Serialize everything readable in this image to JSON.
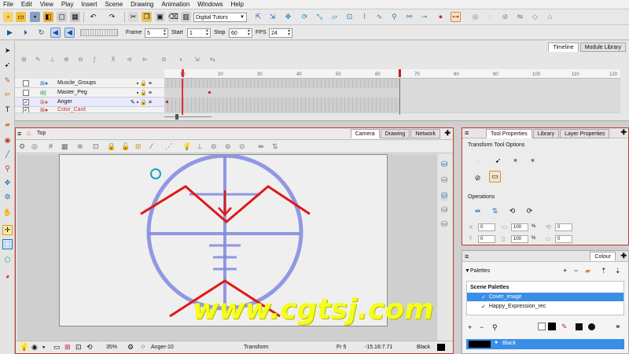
{
  "menu": [
    "File",
    "Edit",
    "View",
    "Play",
    "Insert",
    "Scene",
    "Drawing",
    "Animation",
    "Windows",
    "Help"
  ],
  "toolbar": {
    "workspace": "Digital Tutors",
    "frame_label": "Frame",
    "frame_value": "5",
    "start_label": "Start",
    "start_value": "1",
    "stop_label": "Stop",
    "stop_value": "60",
    "fps_label": "FPS",
    "fps_value": "24"
  },
  "timeline": {
    "tabs": [
      "Timeline",
      "Module Library"
    ],
    "ruler_ticks": [
      "10",
      "20",
      "30",
      "40",
      "50",
      "60",
      "70",
      "80",
      "90",
      "100",
      "110",
      "120"
    ],
    "layers": [
      {
        "name": "Muscle_Groups",
        "checked": false
      },
      {
        "name": "Master_Peg",
        "checked": false
      },
      {
        "name": "Anger",
        "checked": true
      },
      {
        "name": "Color_Card",
        "checked": true
      }
    ]
  },
  "camera": {
    "breadcrumb": "Top",
    "tabs": [
      "Camera",
      "Drawing",
      "Network"
    ],
    "status": {
      "zoom": "35%",
      "drawing": "Anger-10",
      "tool": "Transform",
      "frame": "Fr 5",
      "coords": "-15.16:7.71",
      "color": "Black"
    }
  },
  "tool_properties": {
    "tabs": [
      "Tool Properties",
      "Library",
      "Layer Properties"
    ],
    "section_options": "Transform Tool Options",
    "section_operations": "Operations",
    "fields": {
      "x": "0",
      "y": "0",
      "w": "100",
      "h": "100",
      "angle": "0",
      "skew": "0"
    },
    "percent": "%"
  },
  "colour": {
    "tab": "Colour",
    "palettes_label": "Palettes",
    "scene_palettes": "Scene Palettes",
    "palettes": [
      {
        "name": "Cover_image",
        "selected": true
      },
      {
        "name": "Happy_Expression_rec",
        "selected": false
      }
    ],
    "swatch_name": "Black"
  },
  "watermark": "www.cgtsj.com"
}
